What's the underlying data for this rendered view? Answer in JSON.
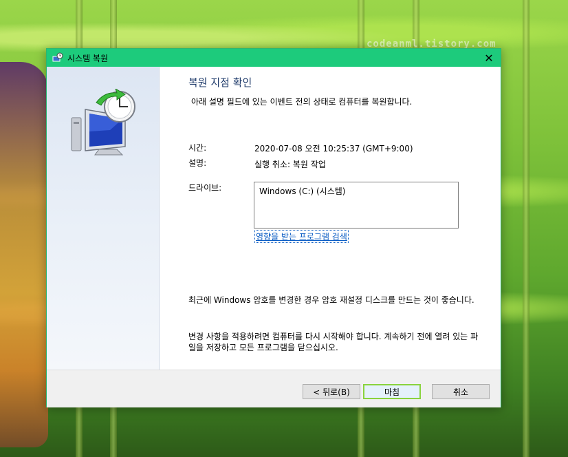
{
  "window": {
    "title": "시스템 복원",
    "close_glyph": "✕"
  },
  "watermark": "codeanml.tistory.com",
  "page": {
    "heading": "복원 지점 확인",
    "subtitle": "아래 설명 필드에 있는 이벤트 전의 상태로 컴퓨터를 복원합니다.",
    "time_label": "시간:",
    "time_value": "2020-07-08 오전 10:25:37 (GMT+9:00)",
    "desc_label": "설명:",
    "desc_value": "실행 취소: 복원 작업",
    "drives_label": "드라이브:",
    "drives": [
      "Windows (C:) (시스템)"
    ],
    "scan_link": "영향을 받는 프로그램 검색",
    "password_note": "최근에 Windows 암호를 변경한 경우 암호 재설정 디스크를 만드는 것이 좋습니다.",
    "restart_note": "변경 사항을 적용하려면 컴퓨터를 다시 시작해야 합니다. 계속하기 전에 열려 있는 파일을 저장하고 모든 프로그램을 닫으십시오."
  },
  "buttons": {
    "back": "< 뒤로(B)",
    "finish": "마침",
    "cancel": "취소"
  },
  "colors": {
    "titlebar": "#1dcb7c",
    "accent_border": "#8ad33d",
    "link": "#0a5cc4",
    "heading": "#1e3a6a"
  },
  "icons": {
    "title": "system-restore-icon",
    "hero": "system-restore-computer-clock-icon"
  }
}
